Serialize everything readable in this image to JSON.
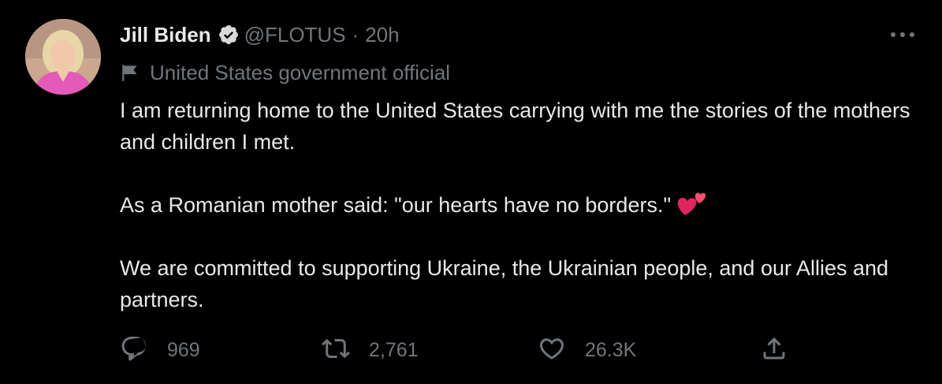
{
  "tweet": {
    "author_name": "Jill Biden",
    "handle": "@FLOTUS",
    "separator": "·",
    "time": "20h",
    "label": "United States government official",
    "body": [
      "I am returning home to the United States carrying with me the stories of the mothers and children I met.",
      "As a Romanian mother said: \"our hearts have no borders.\"",
      "We are committed to supporting Ukraine, the Ukrainian people, and our Allies and partners."
    ],
    "emoji": "two-hearts"
  },
  "actions": {
    "reply_count": "969",
    "retweet_count": "2,761",
    "like_count": "26.3K"
  },
  "icons": {
    "verified": "verified-badge-icon",
    "label": "flag-icon",
    "more": "more-icon",
    "reply": "reply-icon",
    "retweet": "retweet-icon",
    "like": "like-icon",
    "share": "share-icon"
  },
  "colors": {
    "background": "#000000",
    "text": "#e7e9ea",
    "secondary": "#71767b",
    "heart": "#f91880"
  }
}
